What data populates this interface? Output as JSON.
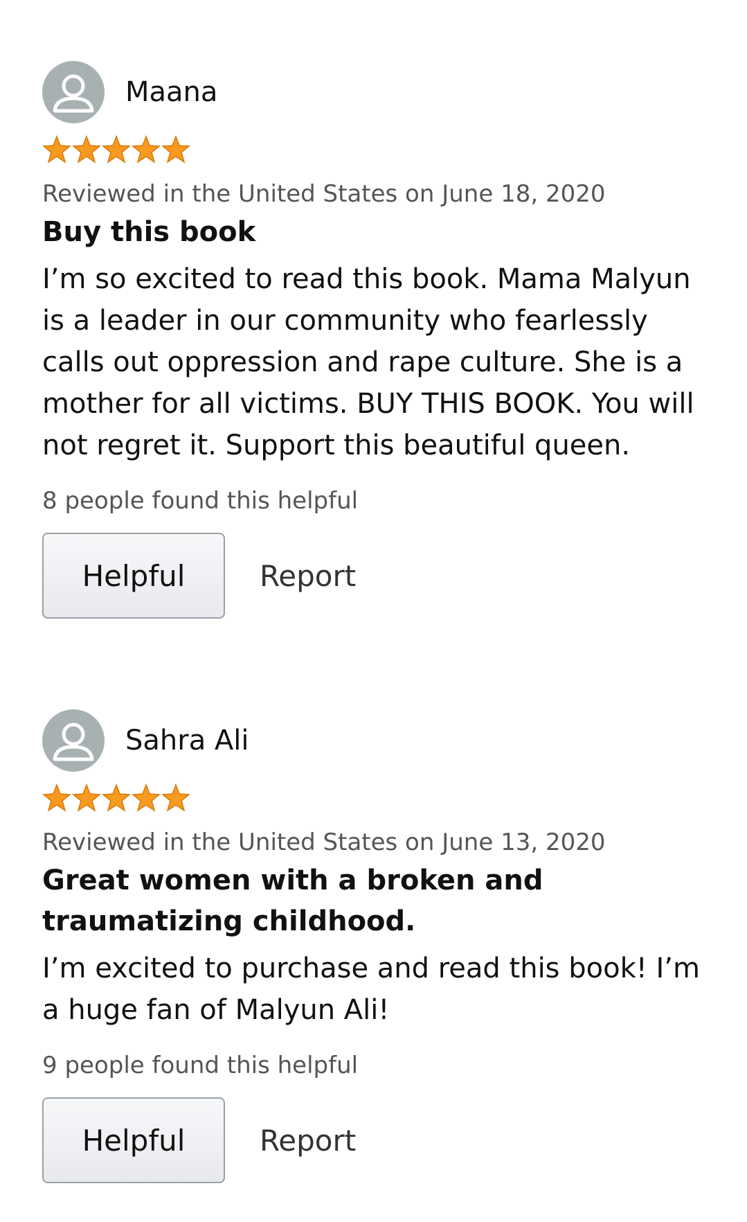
{
  "colors": {
    "star": "#f79a1f",
    "avatar_bg": "#a8b1b2",
    "meta_text": "#555555"
  },
  "reviews": [
    {
      "reviewer": "Maana",
      "avatar_icon": "user-silhouette-icon",
      "rating": 5,
      "date": "Reviewed in the United States on June 18, 2020",
      "title": "Buy this book",
      "body": "I’m so excited to read this book. Mama Malyun is a leader in our community who fearlessly calls out oppression and rape culture. She is a mother for all victims. BUY THIS BOOK. You will not regret it. Support this beautiful queen.",
      "helpful_count": "8 people found this helpful",
      "helpful_label": "Helpful",
      "report_label": "Report"
    },
    {
      "reviewer": "Sahra Ali",
      "avatar_icon": "user-silhouette-icon",
      "rating": 5,
      "date": "Reviewed in the United States on June 13, 2020",
      "title": "Great women with a broken and traumatizing childhood.",
      "body": "I’m excited to purchase and read this book! I’m a huge fan of Malyun Ali!",
      "helpful_count": "9 people found this helpful",
      "helpful_label": "Helpful",
      "report_label": "Report"
    }
  ]
}
